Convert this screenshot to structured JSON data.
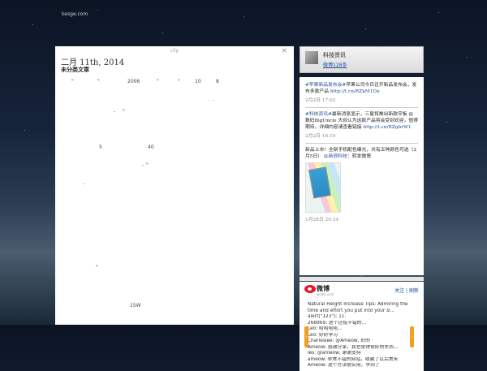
{
  "site": {
    "logo": "kesge.com"
  },
  "post": {
    "clip_label": "clip",
    "close_label": "×",
    "title": "二月 11th, 2014",
    "category": "未分类文章",
    "fragments": [
      "\"",
      "\"",
      "2006",
      "\"",
      "\"",
      "10",
      "8",
      ".",
      ".",
      "-",
      "\"",
      "5",
      "40",
      "-",
      "\"",
      "-",
      "\"",
      "15W"
    ]
  },
  "sidebar": {
    "profile": {
      "name": "科技资讯",
      "count_label": "微博128条"
    },
    "feed": [
      {
        "text_link": "#苹果新品发布会#",
        "text": "苹果公司今日召开新品发布会，发布多款产品 ",
        "url": "http://t.cn/RZkM1Du",
        "time": "2月2日 17:02"
      },
      {
        "text_link": "#科技资讯#",
        "text": "最新消息显示，三星将推出新款平板 @数码BigUncle 大叔认为这款产品将会受到欢迎，值得期待，详细内容请查看链接 ",
        "url": "http://t.cn/RZgbrW1",
        "time": "2月2日 16:19"
      },
      {
        "text_link": "@新浪科技",
        "text": "新品上市！全新手机配色曝光，共有五种颜色可选（2月5日） ",
        "text2": "：转发微博",
        "time": "1月28日 20:34",
        "has_thumb": true
      }
    ],
    "divider_glyph": "︾",
    "weibo": {
      "brand": "微博",
      "sub": "weibo.com",
      "actions": [
        "关注",
        "刷新"
      ],
      "items": [
        "Natural Height Increase Tips: Admiring the",
        "time and effort you put into your si...",
        "alert(\"123\"); 11.",
        "268969: 这个还挺不错的...",
        "Leo: 哈哈哈哈...",
        "Leo: 好好学习",
        "Charleslee: @Ameow, 好的",
        "Ameow: 感谢分享，我也觉得很好的东西...",
        "les: @ameow, 谢谢支持",
        "ameow: 非常不错的网站，收藏了以后常来",
        "Ameow: 这个方法很实用，学到了"
      ]
    },
    "nav": {
      "prev": "‹",
      "next": "›"
    }
  },
  "colors": {
    "accent": "#1a4d9a",
    "weibo_red": "#e6162d",
    "arrow": "#f0a020"
  }
}
